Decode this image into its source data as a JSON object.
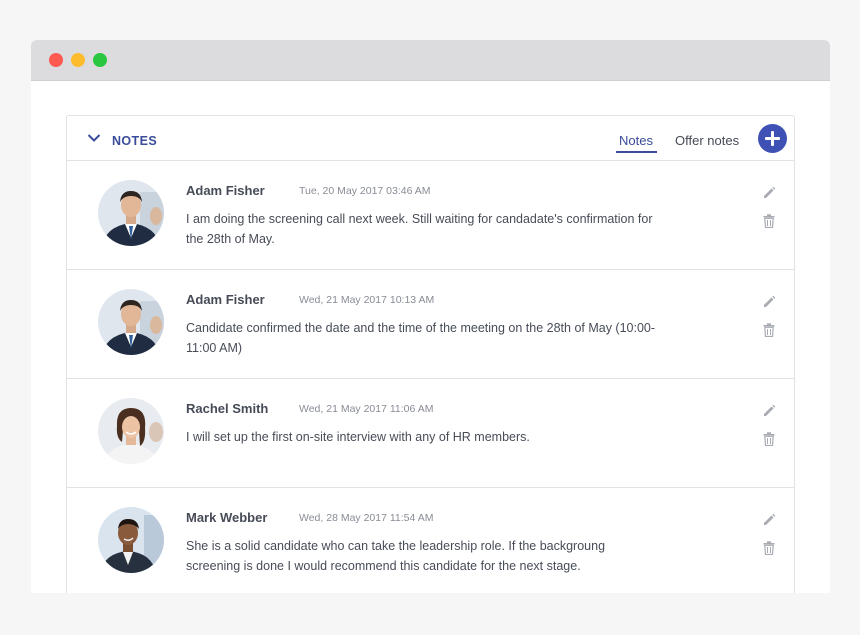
{
  "window": {
    "controls": [
      "close",
      "minimize",
      "maximize"
    ]
  },
  "panel": {
    "title": "NOTES",
    "tabs": [
      {
        "label": "Notes",
        "active": true
      },
      {
        "label": "Offer notes",
        "active": false
      }
    ],
    "add_icon": "plus-icon",
    "accent_color": "#3f51b5"
  },
  "notes": [
    {
      "author": "Adam Fisher",
      "timestamp": "Tue, 20 May 2017 03:46 AM",
      "text": "I am doing the screening call next week. Still waiting for candadate's confirmation for the 28th of May.",
      "avatar": "man-suit"
    },
    {
      "author": "Adam Fisher",
      "timestamp": "Wed, 21 May 2017 10:13 AM",
      "text": "Candidate confirmed the date and the time of the meeting on the 28th of May (10:00-11:00 AM)",
      "avatar": "man-suit"
    },
    {
      "author": "Rachel Smith",
      "timestamp": "Wed, 21 May 2017 11:06 AM",
      "text": "I will set up the first on-site interview with any of HR members.",
      "avatar": "woman"
    },
    {
      "author": "Mark Webber",
      "timestamp": "Wed, 28 May 2017 11:54 AM",
      "text": "She is a solid candidate who can take the leadership role. If the backgroung screening is done I would recommend this candidate for the next stage.",
      "avatar": "man-dark"
    }
  ]
}
